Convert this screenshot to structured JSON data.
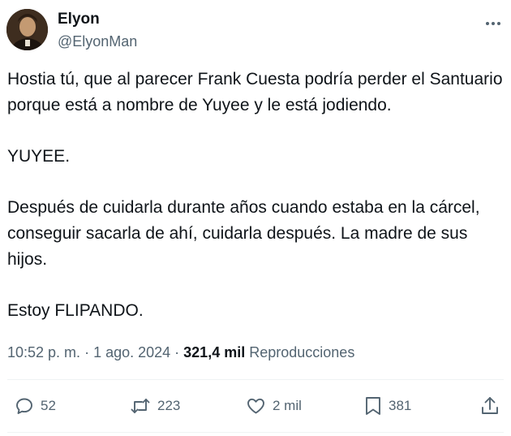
{
  "author": {
    "display_name": "Elyon",
    "handle": "@ElyonMan"
  },
  "tweet": {
    "paragraphs": [
      "Hostia tú, que al parecer Frank Cuesta podría perder el Santuario porque está a nombre de Yuyee y le está jodiendo.",
      "YUYEE.",
      "Después de cuidarla durante años cuando estaba en la cárcel, conseguir sacarla de ahí, cuidarla después. La madre de sus hijos.",
      "Estoy FLIPANDO."
    ]
  },
  "meta": {
    "time": "10:52 p. m.",
    "separator": "·",
    "date": "1 ago. 2024",
    "views_count": "321,4 mil",
    "views_label": "Reproducciones"
  },
  "actions": {
    "replies": "52",
    "reposts": "223",
    "likes": "2 mil",
    "bookmarks": "381"
  },
  "icons": {
    "more": "more-horizontal-icon",
    "reply": "reply-icon",
    "repost": "repost-icon",
    "like": "heart-icon",
    "bookmark": "bookmark-icon",
    "share": "share-icon"
  },
  "colors": {
    "text_primary": "#0f1419",
    "text_secondary": "#536471",
    "divider": "#eff3f4"
  }
}
